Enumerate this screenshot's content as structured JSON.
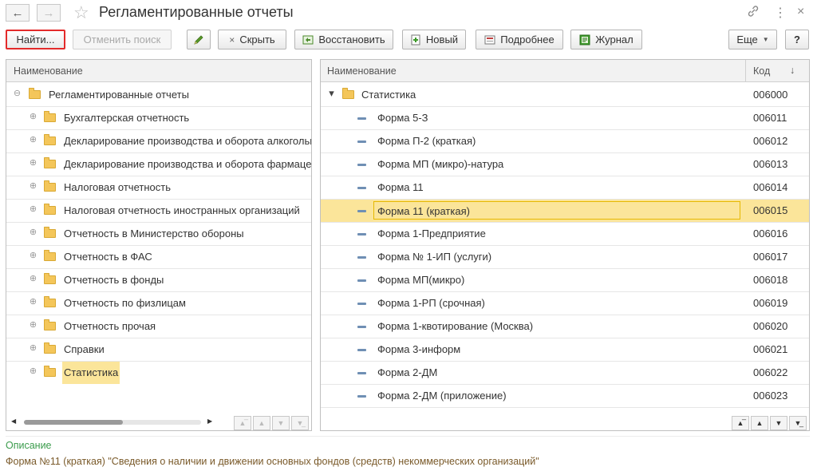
{
  "window": {
    "title": "Регламентированные отчеты"
  },
  "toolbar": {
    "find_label": "Найти...",
    "cancel_search_label": "Отменить поиск",
    "hide_label": "Скрыть",
    "restore_label": "Восстановить",
    "new_label": "Новый",
    "details_label": "Подробнее",
    "journal_label": "Журнал",
    "more_label": "Еще",
    "help_label": "?"
  },
  "left_panel": {
    "header": "Наименование",
    "root": "Регламентированные отчеты",
    "items": [
      {
        "label": "Бухгалтерская отчетность"
      },
      {
        "label": "Декларирование производства и оборота алкогольной продукции"
      },
      {
        "label": "Декларирование производства и оборота фармацевтической продукции"
      },
      {
        "label": "Налоговая отчетность"
      },
      {
        "label": "Налоговая отчетность иностранных организаций"
      },
      {
        "label": "Отчетность в Министерство обороны"
      },
      {
        "label": "Отчетность в ФАС"
      },
      {
        "label": "Отчетность в фонды"
      },
      {
        "label": "Отчетность по физлицам"
      },
      {
        "label": "Отчетность прочая"
      },
      {
        "label": "Справки"
      },
      {
        "label": "Статистика"
      }
    ]
  },
  "right_panel": {
    "header_name": "Наименование",
    "header_code": "Код",
    "sort_icon": "↓",
    "group": {
      "label": "Статистика",
      "code": "006000"
    },
    "rows": [
      {
        "name": "Форма 5-З",
        "code": "006011"
      },
      {
        "name": "Форма П-2 (краткая)",
        "code": "006012"
      },
      {
        "name": "Форма МП (микро)-натура",
        "code": "006013"
      },
      {
        "name": "Форма 11",
        "code": "006014"
      },
      {
        "name": "Форма 11 (краткая)",
        "code": "006015"
      },
      {
        "name": "Форма 1-Предприятие",
        "code": "006016"
      },
      {
        "name": "Форма № 1-ИП (услуги)",
        "code": "006017"
      },
      {
        "name": "Форма МП(микро)",
        "code": "006018"
      },
      {
        "name": "Форма 1-РП (срочная)",
        "code": "006019"
      },
      {
        "name": "Форма 1-квотирование (Москва)",
        "code": "006020"
      },
      {
        "name": "Форма 3-информ",
        "code": "006021"
      },
      {
        "name": "Форма 2-ДМ",
        "code": "006022"
      },
      {
        "name": "Форма 2-ДМ (приложение)",
        "code": "006023"
      }
    ]
  },
  "description": {
    "label": "Описание",
    "text": "Форма №11 (краткая) \"Сведения о наличии и движении основных фондов (средств) некоммерческих организаций\""
  },
  "colors": {
    "selection": "#fbe59a",
    "selection_border": "#e6b800",
    "description_label": "#3b9c4c",
    "description_text": "#7a5a2a",
    "folder": "#f4c65a"
  }
}
